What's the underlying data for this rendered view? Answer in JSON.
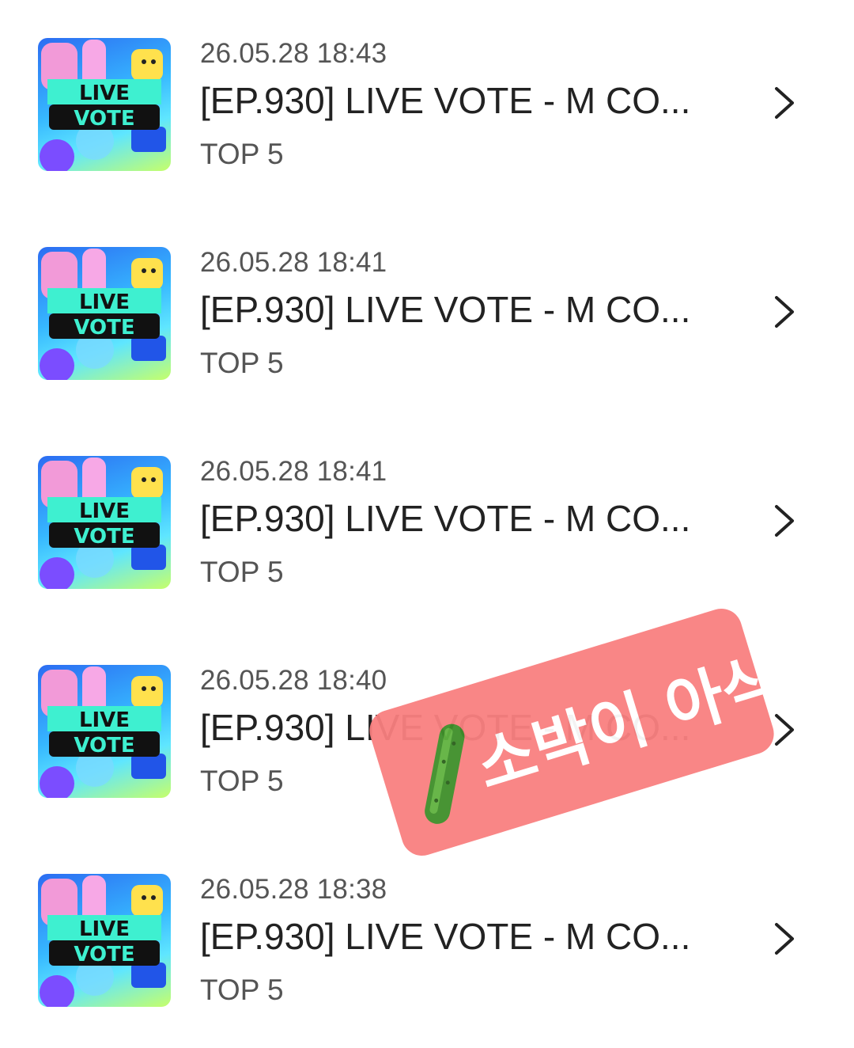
{
  "items": [
    {
      "date": "26.05.28 18:43",
      "title": "[EP.930] LIVE VOTE - M CO...",
      "subtitle": "TOP 5"
    },
    {
      "date": "26.05.28 18:41",
      "title": "[EP.930] LIVE VOTE - M CO...",
      "subtitle": "TOP 5"
    },
    {
      "date": "26.05.28 18:41",
      "title": "[EP.930] LIVE VOTE - M CO...",
      "subtitle": "TOP 5"
    },
    {
      "date": "26.05.28 18:40",
      "title": "[EP.930] LIVE VOTE - M CO...",
      "subtitle": "TOP 5"
    },
    {
      "date": "26.05.28 18:38",
      "title": "[EP.930] LIVE VOTE - M CO...",
      "subtitle": "TOP 5"
    }
  ],
  "thumbnail": {
    "line1": "LIVE",
    "line2": "VOTE"
  },
  "sticker": {
    "text": "소박이 아삭",
    "icon": "cucumber-icon",
    "color": "#f98080"
  },
  "icons": {
    "chevron": "chevron-right-icon"
  }
}
